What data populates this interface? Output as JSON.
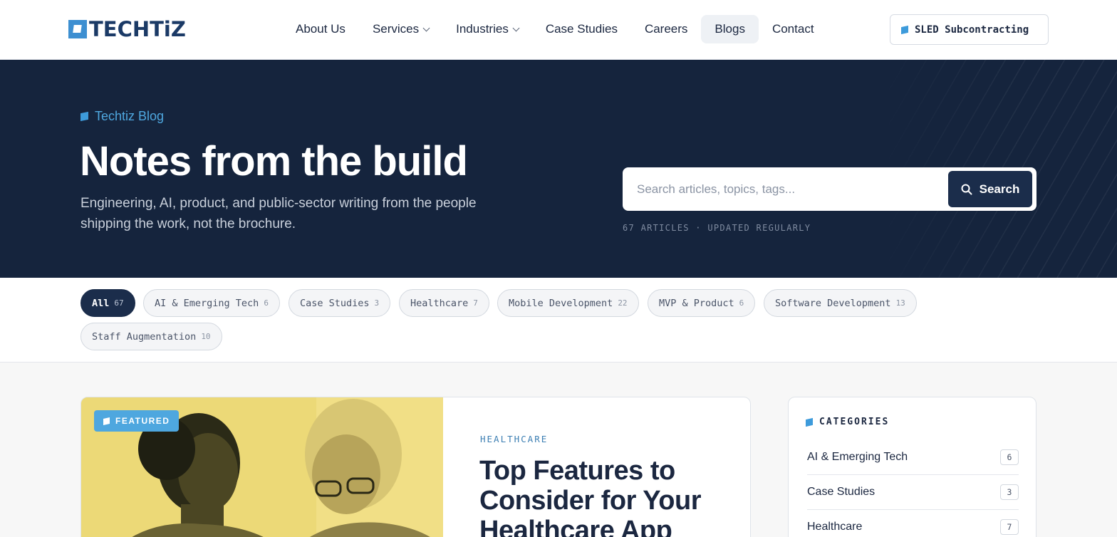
{
  "brand": {
    "logo_text": "TECHTiZ",
    "accent": "#3d9bdb",
    "navy": "#15243d"
  },
  "nav": {
    "items": [
      {
        "label": "About Us",
        "has_dropdown": false,
        "active": false
      },
      {
        "label": "Services",
        "has_dropdown": true,
        "active": false
      },
      {
        "label": "Industries",
        "has_dropdown": true,
        "active": false
      },
      {
        "label": "Case Studies",
        "has_dropdown": false,
        "active": false
      },
      {
        "label": "Careers",
        "has_dropdown": false,
        "active": false
      },
      {
        "label": "Blogs",
        "has_dropdown": false,
        "active": true
      },
      {
        "label": "Contact",
        "has_dropdown": false,
        "active": false
      }
    ],
    "cta_label": "SLED Subcontracting"
  },
  "hero": {
    "eyebrow": "Techtiz Blog",
    "title": "Notes from the build",
    "description": "Engineering, AI, product, and public-sector writing from the people shipping the work, not the brochure.",
    "search_placeholder": "Search articles, topics, tags...",
    "search_button": "Search",
    "meta": "67 ARTICLES · UPDATED REGULARLY"
  },
  "filters": [
    {
      "label": "All",
      "count": "67",
      "active": true
    },
    {
      "label": "AI & Emerging Tech",
      "count": "6",
      "active": false
    },
    {
      "label": "Case Studies",
      "count": "3",
      "active": false
    },
    {
      "label": "Healthcare",
      "count": "7",
      "active": false
    },
    {
      "label": "Mobile Development",
      "count": "22",
      "active": false
    },
    {
      "label": "MVP & Product",
      "count": "6",
      "active": false
    },
    {
      "label": "Software Development",
      "count": "13",
      "active": false
    },
    {
      "label": "Staff Augmentation",
      "count": "10",
      "active": false
    }
  ],
  "featured": {
    "badge": "FEATURED",
    "category": "HEALTHCARE",
    "title": "Top Features to Consider for Your Healthcare App"
  },
  "sidebar": {
    "heading": "CATEGORIES",
    "categories": [
      {
        "label": "AI & Emerging Tech",
        "count": "6"
      },
      {
        "label": "Case Studies",
        "count": "3"
      },
      {
        "label": "Healthcare",
        "count": "7"
      }
    ]
  }
}
